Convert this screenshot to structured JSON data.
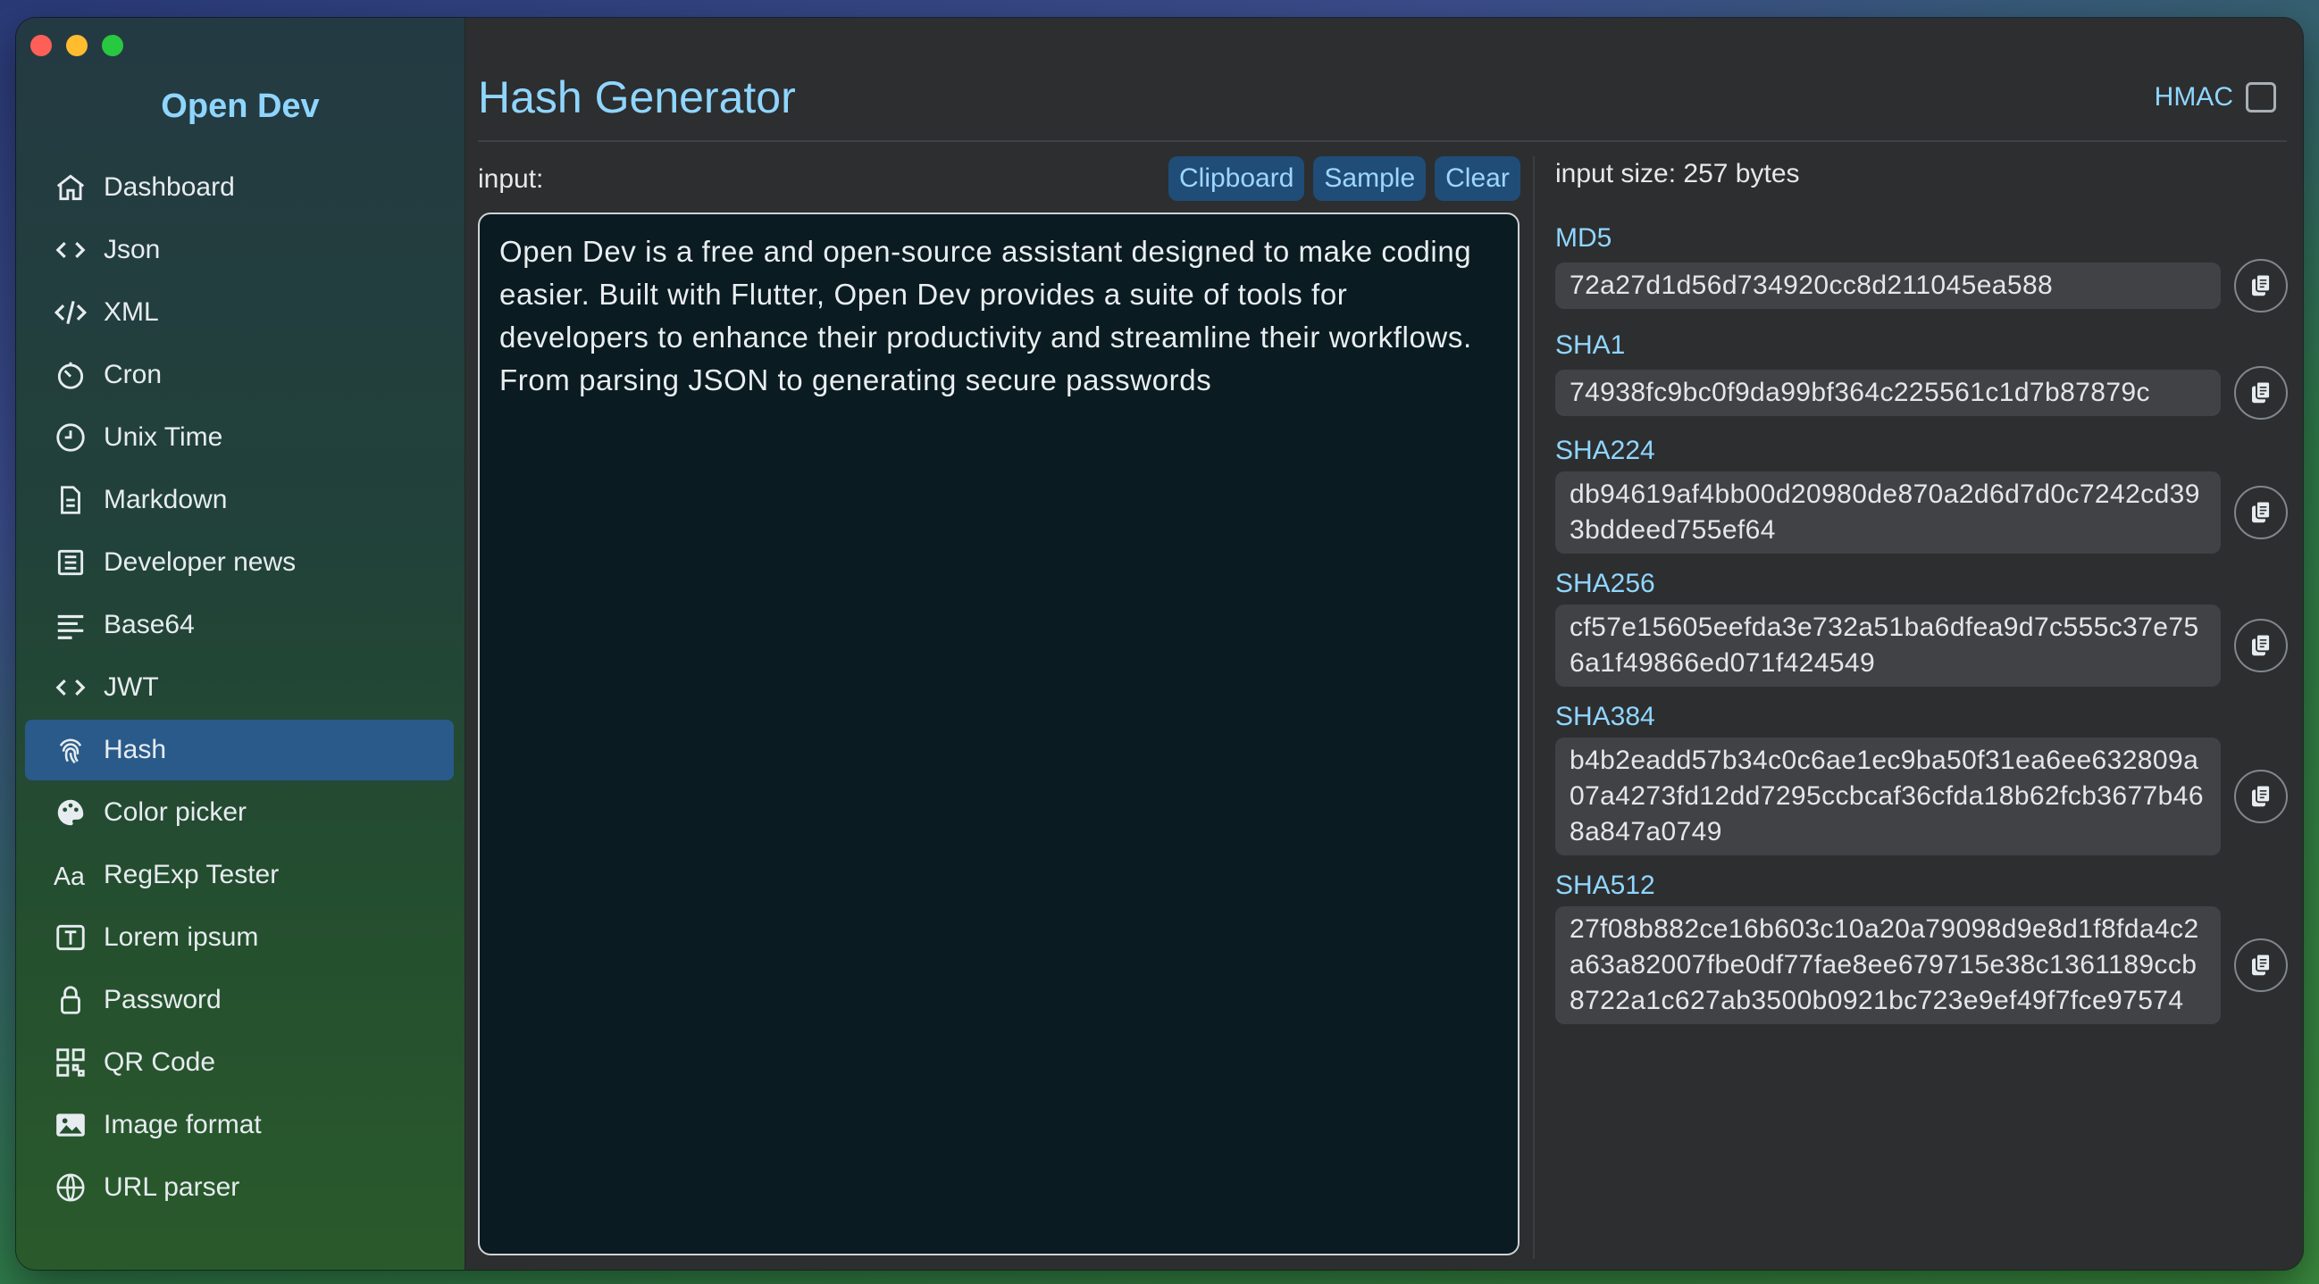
{
  "app": {
    "title": "Open Dev"
  },
  "sidebar": {
    "items": [
      {
        "label": "Dashboard",
        "icon": "home-icon"
      },
      {
        "label": "Json",
        "icon": "code-icon"
      },
      {
        "label": "XML",
        "icon": "code-slash-icon"
      },
      {
        "label": "Cron",
        "icon": "timer-icon"
      },
      {
        "label": "Unix Time",
        "icon": "clock-icon"
      },
      {
        "label": "Markdown",
        "icon": "document-icon"
      },
      {
        "label": "Developer news",
        "icon": "newspaper-icon"
      },
      {
        "label": "Base64",
        "icon": "lines-icon"
      },
      {
        "label": "JWT",
        "icon": "code-icon"
      },
      {
        "label": "Hash",
        "icon": "fingerprint-icon",
        "active": true
      },
      {
        "label": "Color picker",
        "icon": "palette-icon"
      },
      {
        "label": "RegExp Tester",
        "icon": "text-aa-icon"
      },
      {
        "label": "Lorem ipsum",
        "icon": "text-box-icon"
      },
      {
        "label": "Password",
        "icon": "lock-icon"
      },
      {
        "label": "QR Code",
        "icon": "qr-code-icon"
      },
      {
        "label": "Image format",
        "icon": "image-icon"
      },
      {
        "label": "URL parser",
        "icon": "globe-icon"
      }
    ]
  },
  "main": {
    "title": "Hash Generator",
    "hmac_label": "HMAC",
    "input_label": "input:",
    "buttons": {
      "clipboard": "Clipboard",
      "sample": "Sample",
      "clear": "Clear"
    },
    "input_text": "Open Dev is a free and open-source assistant designed to make coding easier. Built with Flutter, Open Dev provides a suite of tools for developers to enhance their productivity and streamline their workflows. From parsing JSON to generating secure passwords",
    "input_size": "input size: 257 bytes",
    "hashes": [
      {
        "name": "MD5",
        "value": "72a27d1d56d734920cc8d211045ea588"
      },
      {
        "name": "SHA1",
        "value": "74938fc9bc0f9da99bf364c225561c1d7b87879c"
      },
      {
        "name": "SHA224",
        "value": "db94619af4bb00d20980de870a2d6d7d0c7242cd393bddeed755ef64"
      },
      {
        "name": "SHA256",
        "value": "cf57e15605eefda3e732a51ba6dfea9d7c555c37e756a1f49866ed071f424549"
      },
      {
        "name": "SHA384",
        "value": "b4b2eadd57b34c0c6ae1ec9ba50f31ea6ee632809a07a4273fd12dd7295ccbcaf36cfda18b62fcb3677b468a847a0749"
      },
      {
        "name": "SHA512",
        "value": "27f08b882ce16b603c10a20a79098d9e8d1f8fda4c2a63a82007fbe0df77fae8ee679715e38c1361189ccb8722a1c627ab3500b0921bc723e9ef49f7fce97574"
      }
    ]
  },
  "colors": {
    "accent": "#8fd6ff",
    "active_bg": "#2a5a8a",
    "button_bg": "#1f4d78"
  }
}
